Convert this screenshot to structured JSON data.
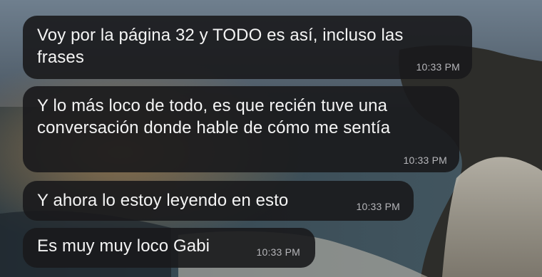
{
  "messages": [
    {
      "text": "Voy por la página 32 y TODO es así, incluso las\nfrases",
      "time": "10:33 PM"
    },
    {
      "text": "Y lo más loco de todo, es que recién tuve una\nconversación donde hable de cómo me sentía",
      "time": "10:33 PM"
    },
    {
      "text": "Y ahora lo estoy leyendo en esto",
      "time": "10:33 PM"
    },
    {
      "text": "Es muy muy loco Gabi",
      "time": "10:33 PM"
    }
  ],
  "colors": {
    "bubble_bg": "#1a1a1c",
    "text": "#f4f4f4",
    "timestamp": "#b6b6ba"
  }
}
